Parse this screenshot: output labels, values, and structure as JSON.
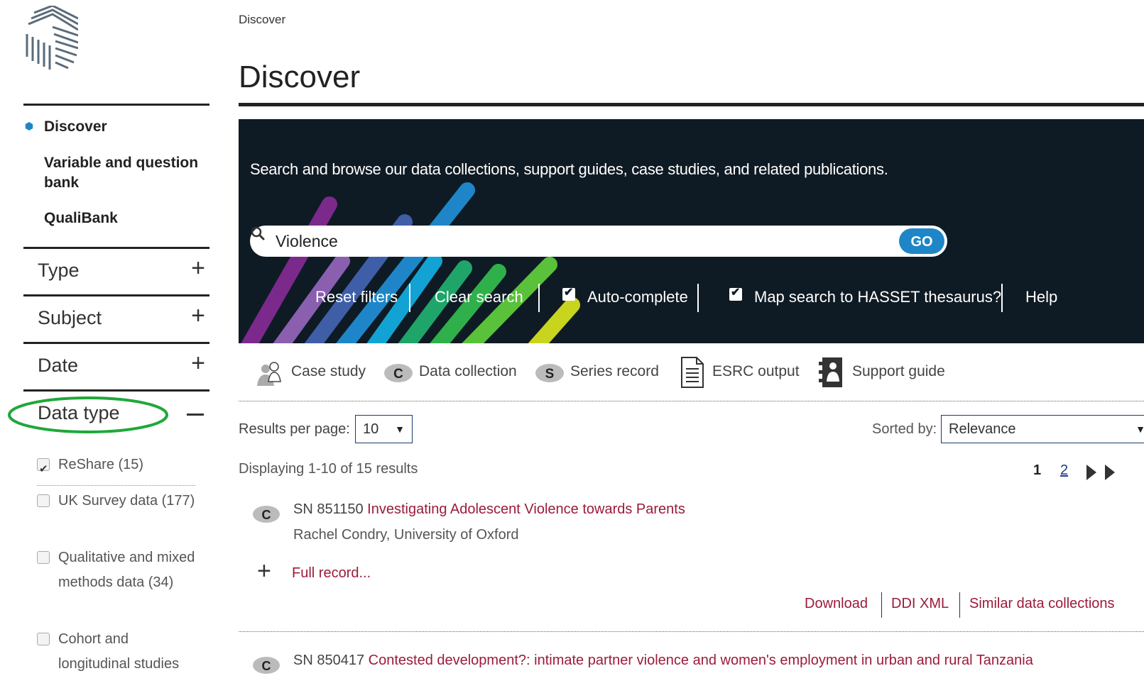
{
  "sidebar": {
    "nav": [
      {
        "label": "Discover"
      },
      {
        "label": "Variable and question bank"
      },
      {
        "label": "QualiBank"
      }
    ],
    "facets": [
      {
        "label": "Type",
        "state": "+"
      },
      {
        "label": "Subject",
        "state": "+"
      },
      {
        "label": "Date",
        "state": "+"
      },
      {
        "label": "Data type",
        "state": "−"
      }
    ],
    "data_type_options": [
      {
        "label": "ReShare (15)",
        "checked": true
      },
      {
        "label": "UK Survey data (177)",
        "checked": false
      },
      {
        "label": "Qualitative and mixed methods data (34)",
        "checked": false
      },
      {
        "label": "Cohort and longitudinal studies",
        "checked": false
      }
    ]
  },
  "breadcrumb": "Discover",
  "page_title": "Discover",
  "banner": {
    "intro": "Search and browse our data collections, support guides, case studies, and related publications.",
    "search_value": "Violence",
    "go_label": "GO",
    "reset_filters": "Reset filters",
    "clear_search": "Clear search",
    "autocomplete_label": "Auto-complete",
    "hasset_label": "Map search to HASSET thesaurus?",
    "help_label": "Help"
  },
  "types": [
    {
      "label": "Case study",
      "icon": "case-study-icon"
    },
    {
      "label": "Data collection",
      "icon": "data-collection-icon"
    },
    {
      "label": "Series record",
      "icon": "series-record-icon"
    },
    {
      "label": "ESRC output",
      "icon": "esrc-output-icon"
    },
    {
      "label": "Support guide",
      "icon": "support-guide-icon"
    }
  ],
  "controls": {
    "rpp_label": "Results per page:",
    "rpp_value": "10",
    "sort_label": "Sorted by:",
    "sort_value": "Relevance",
    "displaying": "Displaying 1-10 of 15 results",
    "current_page": "1",
    "next_page": "2"
  },
  "results": [
    {
      "sn": "SN 851150",
      "title": "Investigating Adolescent Violence towards Parents",
      "author": "Rachel Condry, University of Oxford",
      "full_record": "Full record...",
      "actions": [
        "Download",
        "DDI XML",
        "Similar data collections"
      ]
    },
    {
      "sn": "SN 850417",
      "title": "Contested development?: intimate partner violence and women's employment in urban and rural Tanzania"
    }
  ],
  "colors": {
    "banner_bg": "#0f1b24",
    "go_button": "#1e86c8",
    "link_red": "#9b1b3a",
    "oval_green": "#1fa83a"
  }
}
